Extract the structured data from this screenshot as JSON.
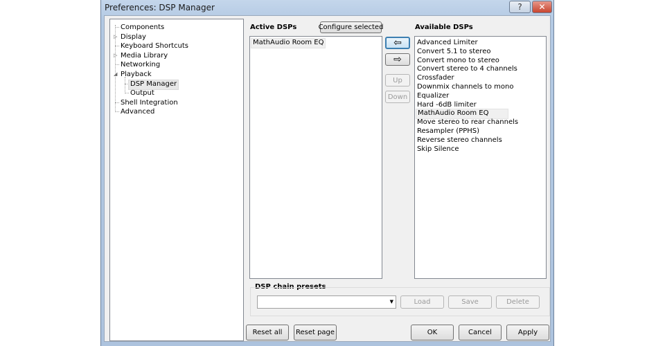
{
  "window": {
    "title": "Preferences: DSP Manager",
    "help_glyph": "?",
    "close_glyph": "✕"
  },
  "tree": {
    "items": [
      {
        "label": "Components",
        "level": 0,
        "expander": ""
      },
      {
        "label": "Display",
        "level": 0,
        "expander": "▷"
      },
      {
        "label": "Keyboard Shortcuts",
        "level": 0,
        "expander": ""
      },
      {
        "label": "Media Library",
        "level": 0,
        "expander": "▷"
      },
      {
        "label": "Networking",
        "level": 0,
        "expander": ""
      },
      {
        "label": "Playback",
        "level": 0,
        "expander": "◢"
      },
      {
        "label": "DSP Manager",
        "level": 1,
        "expander": "",
        "selected": true
      },
      {
        "label": "Output",
        "level": 1,
        "expander": ""
      },
      {
        "label": "Shell Integration",
        "level": 0,
        "expander": ""
      },
      {
        "label": "Advanced",
        "level": 0,
        "expander": ""
      }
    ]
  },
  "active": {
    "title": "Active DSPs",
    "configure_label": "Configure selected",
    "items": [
      "MathAudio Room EQ"
    ]
  },
  "middle": {
    "add_glyph": "⇦",
    "remove_glyph": "⇨",
    "up_label": "Up",
    "down_label": "Down"
  },
  "available": {
    "title": "Available DSPs",
    "items": [
      "Advanced Limiter",
      "Convert 5.1 to stereo",
      "Convert mono to stereo",
      "Convert stereo to 4 channels",
      "Crossfader",
      "Downmix channels to mono",
      "Equalizer",
      "Hard -6dB limiter",
      "MathAudio Room EQ",
      "Move stereo to rear channels",
      "Resampler (PPHS)",
      "Reverse stereo channels",
      "Skip Silence"
    ],
    "selected_index": 8
  },
  "presets": {
    "title": "DSP chain presets",
    "combo_value": "",
    "combo_arrow": "▼",
    "load_label": "Load",
    "save_label": "Save",
    "delete_label": "Delete"
  },
  "footer": {
    "reset_all_label": "Reset all",
    "reset_page_label": "Reset page",
    "ok_label": "OK",
    "cancel_label": "Cancel",
    "apply_label": "Apply"
  }
}
